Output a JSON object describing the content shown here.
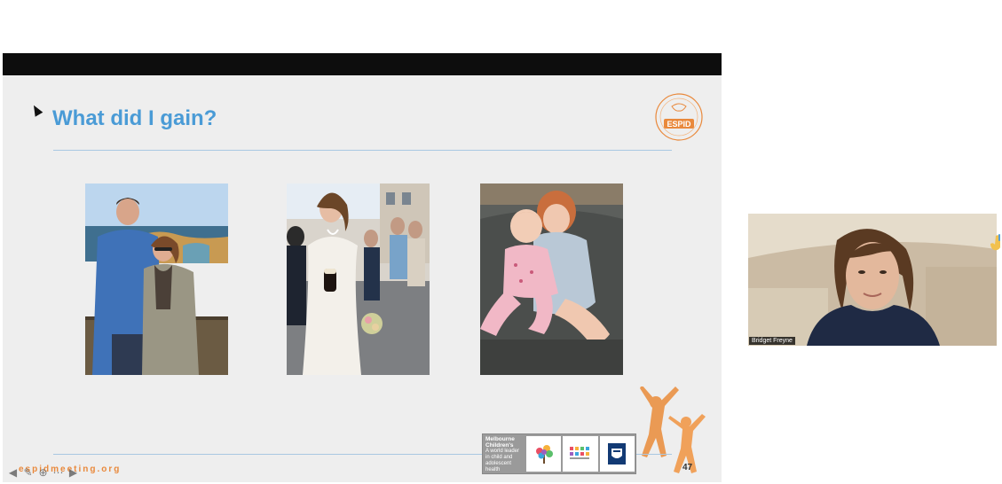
{
  "slide": {
    "title": "What did I gain?",
    "logo_text": "ESPID",
    "slide_number": "47",
    "footer_url": "espidmeeting.org",
    "partner_block": {
      "title": "Melbourne Children's",
      "subtitle": "A world leader in child and adolescent health"
    },
    "photos": [
      {
        "alt": "couple-by-sea"
      },
      {
        "alt": "bride-with-drink"
      },
      {
        "alt": "two-children-on-sofa"
      }
    ],
    "controls": [
      "previous",
      "pen",
      "zoom",
      "more",
      "next"
    ]
  },
  "participant": {
    "name": "Bridget Freyne"
  },
  "colors": {
    "title": "#4a9bd6",
    "accent_orange": "#e9893c",
    "slide_bg": "#eeeeee",
    "rule": "#a9c8e2"
  }
}
